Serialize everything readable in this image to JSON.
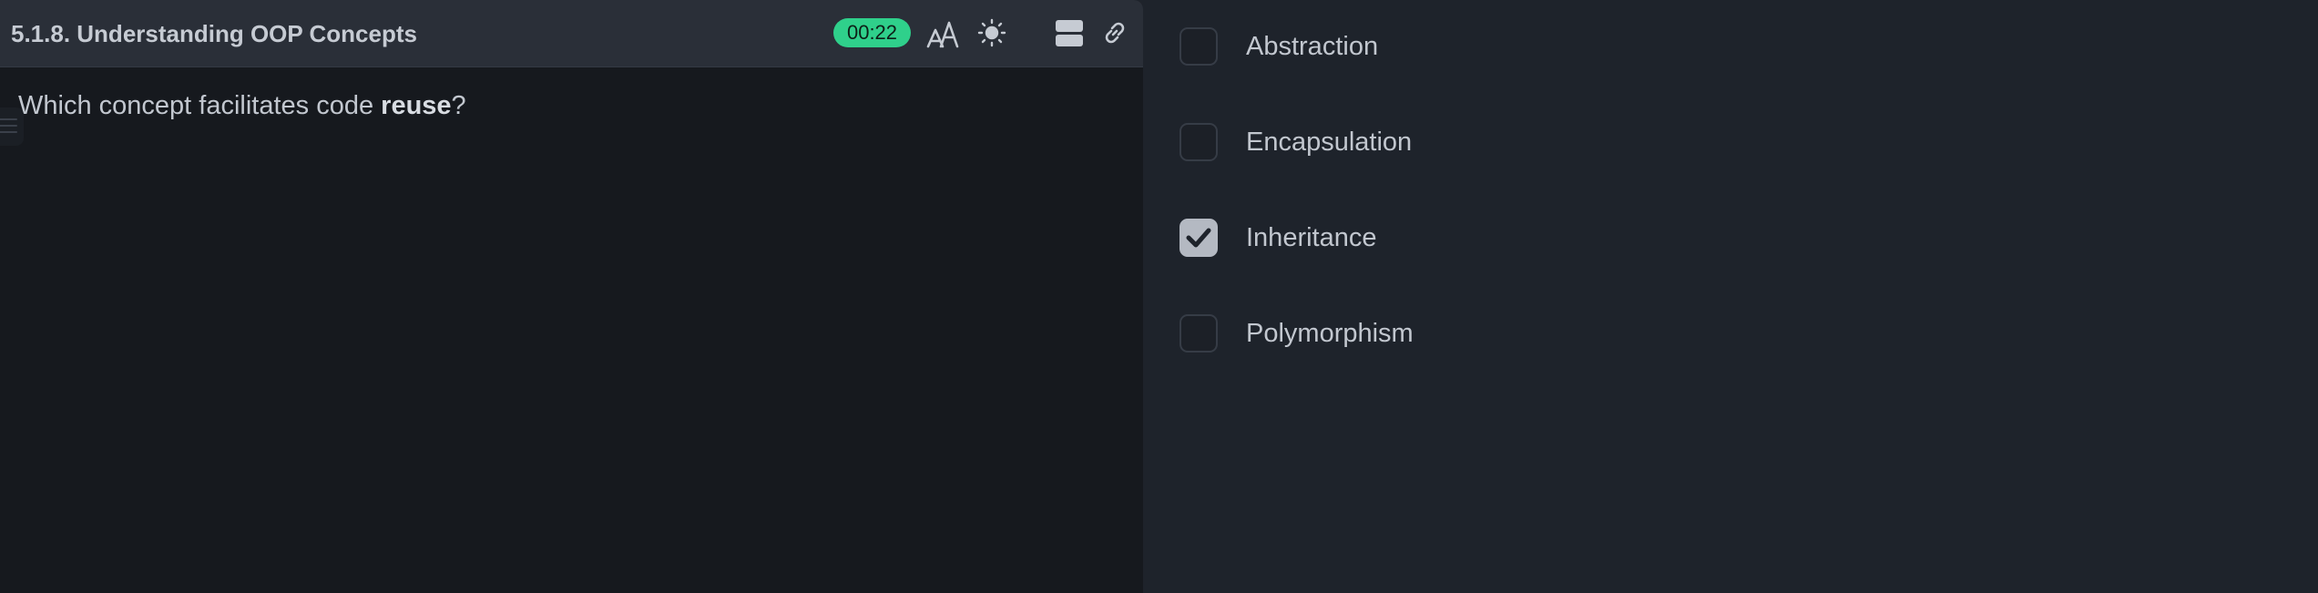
{
  "header": {
    "title": "5.1.8. Understanding OOP Concepts",
    "timer": "00:22",
    "icons": [
      "font-size-icon",
      "brightness-icon",
      "layout-icon",
      "link-icon"
    ]
  },
  "question": {
    "prefix": "Which concept facilitates code ",
    "emphasis": "reuse",
    "suffix": "?"
  },
  "options": [
    {
      "label": "Abstraction",
      "checked": false
    },
    {
      "label": "Encapsulation",
      "checked": false
    },
    {
      "label": "Inheritance",
      "checked": true
    },
    {
      "label": "Polymorphism",
      "checked": false
    }
  ],
  "colors": {
    "timer_bg": "#2fd08b",
    "left_panel_bg": "#16191e",
    "right_panel_bg": "#1e232b",
    "header_bg": "#2a2f38"
  }
}
